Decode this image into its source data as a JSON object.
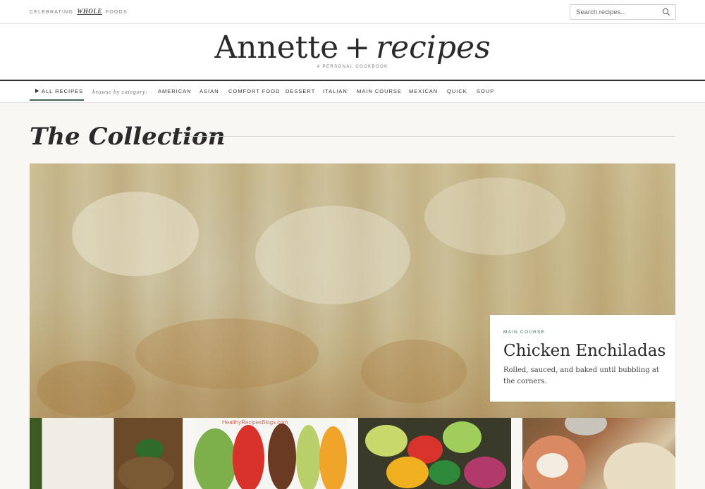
{
  "topbar": {
    "tagline_prefix": "CELEBRATING",
    "tagline_highlight": "WHOLE",
    "tagline_suffix": "FOODS",
    "search_placeholder": "Search recipes...",
    "search_icon": "search-icon"
  },
  "header": {
    "logo_main": "Annette",
    "logo_plus": "+",
    "logo_script": "recipes",
    "subtitle": "A PERSONAL COOKBOOK"
  },
  "nav": {
    "all_label": "ALL RECIPES",
    "browse_label": "browse by category:",
    "categories": [
      "AMERICAN",
      "ASIAN",
      "COMFORT FOOD",
      "DESSERT",
      "ITALIAN",
      "MAIN COURSE",
      "MEXICAN",
      "QUICK",
      "SOUP"
    ]
  },
  "collection": {
    "title": "The Collection"
  },
  "feature": {
    "category": "MAIN COURSE",
    "title": "Chicken Enchiladas",
    "description": "Rolled, sauced, and baked until bubbling at the corners."
  },
  "thumbnails": [
    {
      "name": "thumb-rice-chicken"
    },
    {
      "name": "thumb-taco-salad",
      "watermark": "HealthyRecipesBlogs.com"
    },
    {
      "name": "thumb-bean-salad"
    },
    {
      "name": "thumb-dip-bowls"
    }
  ],
  "colors": {
    "accent": "#3f6b55",
    "background": "#f8f7f3",
    "text": "#2a2a2a"
  }
}
